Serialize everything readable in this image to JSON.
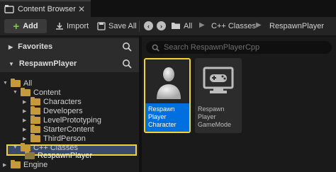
{
  "tab": {
    "title": "Content Browser",
    "close": "✕"
  },
  "toolbar": {
    "add_label": "Add",
    "import_label": "Import",
    "save_all_label": "Save All",
    "breadcrumbs": [
      "All",
      "C++ Classes",
      "RespawnPlayer"
    ]
  },
  "sidebar": {
    "favorites_label": "Favorites",
    "project_label": "RespawnPlayer",
    "tree": [
      {
        "label": "All",
        "depth": 0,
        "expanded": true,
        "kind": "folder"
      },
      {
        "label": "Content",
        "depth": 1,
        "expanded": true,
        "kind": "folder"
      },
      {
        "label": "Characters",
        "depth": 2,
        "expanded": false,
        "kind": "folder"
      },
      {
        "label": "Developers",
        "depth": 2,
        "expanded": false,
        "kind": "folder"
      },
      {
        "label": "LevelPrototyping",
        "depth": 2,
        "expanded": false,
        "kind": "folder"
      },
      {
        "label": "StarterContent",
        "depth": 2,
        "expanded": false,
        "kind": "folder"
      },
      {
        "label": "ThirdPerson",
        "depth": 2,
        "expanded": false,
        "kind": "folder"
      },
      {
        "label": "C++ Classes",
        "depth": 1,
        "expanded": true,
        "kind": "folder"
      },
      {
        "label": "RespawnPlayer",
        "depth": 2,
        "expanded": false,
        "kind": "code",
        "selected": true
      },
      {
        "label": "Engine",
        "depth": 0,
        "expanded": false,
        "kind": "folder"
      }
    ]
  },
  "content": {
    "search_placeholder": "Search RespawnPlayerCpp",
    "assets": [
      {
        "label": "Respawn Player Character",
        "icon": "character-icon",
        "selected": true
      },
      {
        "label": "Respawn Player GameMode",
        "icon": "gamemode-icon",
        "selected": false
      }
    ]
  },
  "colors": {
    "accent": "#0070e0",
    "highlight": "#f0d23a",
    "add_plus": "#7ec850",
    "folder": "#c59a3c"
  }
}
